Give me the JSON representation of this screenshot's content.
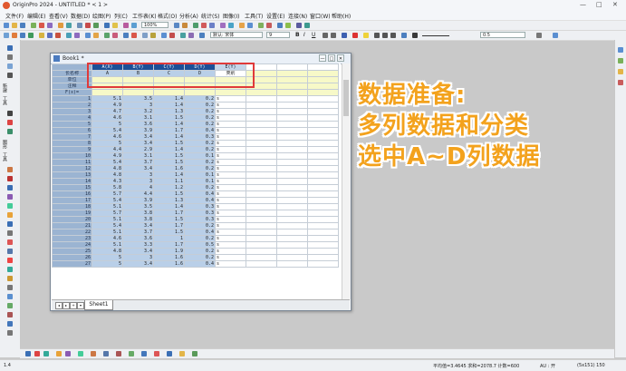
{
  "app": {
    "title": "OriginPro 2024 - UNTITLED * < 1 >",
    "window_controls": [
      "—",
      "□",
      "✕"
    ]
  },
  "menu": [
    "文件(F)",
    "编辑(E)",
    "查看(V)",
    "数据(D)",
    "绘图(P)",
    "列(C)",
    "工作表(K)",
    "格式(O)",
    "分析(A)",
    "统计(S)",
    "图像(I)",
    "工具(T)",
    "设置(E)",
    "连接(N)",
    "窗口(W)",
    "帮助(H)"
  ],
  "toolbar": {
    "zoom": "100%",
    "font": "默认: 宋体",
    "font_size": "9",
    "line_width": "0.5",
    "bold": "B",
    "italic": "I",
    "underline": "U"
  },
  "left_toolbar_labels": [
    "新建",
    "工具",
    "图形",
    "工具",
    "绘图",
    "工具"
  ],
  "book": {
    "title": "Book1 *",
    "row_labels": [
      "长名称",
      "单位",
      "注释",
      "F(x)="
    ],
    "columns": [
      {
        "header": "A(X)",
        "long_name": "A",
        "unit": "",
        "comment": ""
      },
      {
        "header": "B(Y)",
        "long_name": "B",
        "unit": "",
        "comment": ""
      },
      {
        "header": "C(Y)",
        "long_name": "C",
        "unit": "",
        "comment": ""
      },
      {
        "header": "D(Y)",
        "long_name": "D",
        "unit": "",
        "comment": ""
      },
      {
        "header": "E(Y)",
        "long_name": "类别",
        "unit": "",
        "comment": ""
      }
    ],
    "rows": [
      [
        "1",
        "5.1",
        "3.5",
        "1.4",
        "0.2",
        "s"
      ],
      [
        "2",
        "4.9",
        "3",
        "1.4",
        "0.2",
        "s"
      ],
      [
        "3",
        "4.7",
        "3.2",
        "1.3",
        "0.2",
        "s"
      ],
      [
        "4",
        "4.6",
        "3.1",
        "1.5",
        "0.2",
        "s"
      ],
      [
        "5",
        "5",
        "3.6",
        "1.4",
        "0.2",
        "s"
      ],
      [
        "6",
        "5.4",
        "3.9",
        "1.7",
        "0.4",
        "s"
      ],
      [
        "7",
        "4.6",
        "3.4",
        "1.4",
        "0.3",
        "s"
      ],
      [
        "8",
        "5",
        "3.4",
        "1.5",
        "0.2",
        "s"
      ],
      [
        "9",
        "4.4",
        "2.9",
        "1.4",
        "0.2",
        "s"
      ],
      [
        "10",
        "4.9",
        "3.1",
        "1.5",
        "0.1",
        "s"
      ],
      [
        "11",
        "5.4",
        "3.7",
        "1.5",
        "0.2",
        "s"
      ],
      [
        "12",
        "4.8",
        "3.4",
        "1.6",
        "0.2",
        "s"
      ],
      [
        "13",
        "4.8",
        "3",
        "1.4",
        "0.1",
        "s"
      ],
      [
        "14",
        "4.3",
        "3",
        "1.1",
        "0.1",
        "s"
      ],
      [
        "15",
        "5.8",
        "4",
        "1.2",
        "0.2",
        "s"
      ],
      [
        "16",
        "5.7",
        "4.4",
        "1.5",
        "0.4",
        "s"
      ],
      [
        "17",
        "5.4",
        "3.9",
        "1.3",
        "0.4",
        "s"
      ],
      [
        "18",
        "5.1",
        "3.5",
        "1.4",
        "0.3",
        "s"
      ],
      [
        "19",
        "5.7",
        "3.8",
        "1.7",
        "0.3",
        "s"
      ],
      [
        "20",
        "5.1",
        "3.8",
        "1.5",
        "0.3",
        "s"
      ],
      [
        "21",
        "5.4",
        "3.4",
        "1.7",
        "0.2",
        "s"
      ],
      [
        "22",
        "5.1",
        "3.7",
        "1.5",
        "0.4",
        "s"
      ],
      [
        "23",
        "4.6",
        "3.6",
        "1",
        "0.2",
        "s"
      ],
      [
        "24",
        "5.1",
        "3.3",
        "1.7",
        "0.5",
        "s"
      ],
      [
        "25",
        "4.8",
        "3.4",
        "1.9",
        "0.2",
        "s"
      ],
      [
        "26",
        "5",
        "3",
        "1.6",
        "0.2",
        "s"
      ],
      [
        "27",
        "5",
        "3.4",
        "1.6",
        "0.4",
        "s"
      ]
    ],
    "sheet_tab": "Sheet1",
    "nav_buttons": [
      "◂",
      "▸",
      "+",
      "▾"
    ]
  },
  "overlay": {
    "line1": "数据准备:",
    "line2": "多列数据和分类",
    "line3": "选中A~D列数据"
  },
  "status": {
    "left": "1.4",
    "stats": "平均值=3.4645 求和=2078.7 计数=600",
    "au": "AU : 开",
    "cell": "(5x151) 150"
  },
  "colors": {
    "header_blue": "#1c4f97",
    "selected_cell": "#b9cfe8",
    "highlight_box": "#e03a3a",
    "overlay_text": "#f3a21d"
  }
}
